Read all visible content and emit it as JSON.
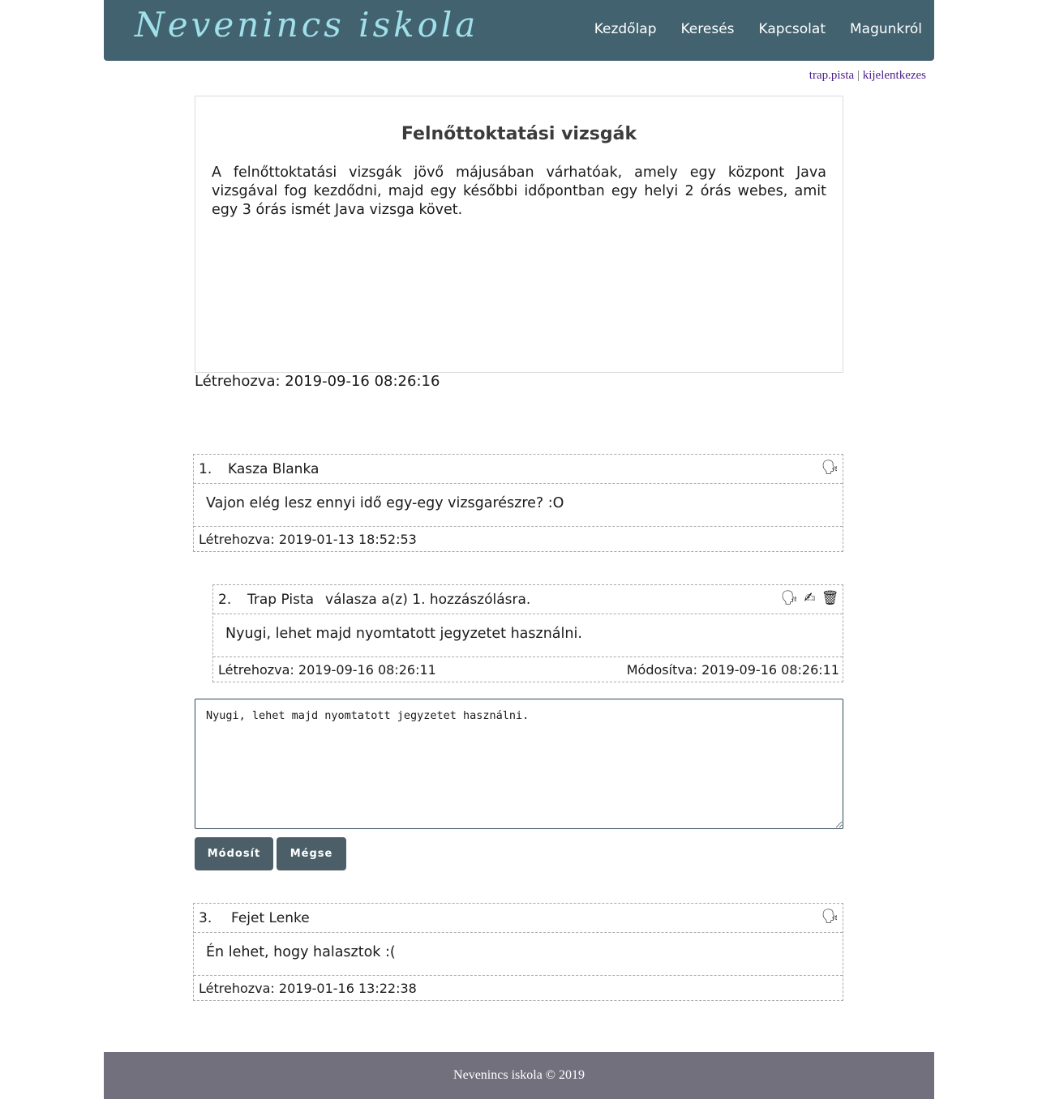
{
  "header": {
    "logo": "Nevenincs iskola",
    "nav": [
      "Kezdőlap",
      "Keresés",
      "Kapcsolat",
      "Magunkról"
    ]
  },
  "user": {
    "username": "trap.pista",
    "separator": "|",
    "logout": "kijelentkezes"
  },
  "article": {
    "title": "Felnőttoktatási vizsgák",
    "body": "A felnőttoktatási vizsgák jövő májusában várhatóak, amely egy központ Java vizsgával fog kezdődni, majd egy későbbi időpontban egy helyi 2 órás webes, amit egy 3 órás ismét Java vizsga követ.",
    "created": "Létrehozva: 2019-09-16 08:26:16"
  },
  "comments": [
    {
      "num": "1.",
      "author": "Kasza Blanka",
      "text": "Vajon elég lesz ennyi idő egy-egy vizsgarészre? :O",
      "created": "Létrehozva: 2019-01-13 18:52:53",
      "icons": [
        "speaking-head-icon"
      ]
    },
    {
      "num": "2.",
      "author": "Trap Pista",
      "reply_to": "válasza a(z) 1. hozzászólásra.",
      "text": "Nyugi, lehet majd nyomtatott jegyzetet használni.",
      "created": "Létrehozva: 2019-09-16 08:26:11",
      "modified": "Módosítva: 2019-09-16 08:26:11",
      "icons": [
        "speaking-head-icon",
        "writing-hand-icon",
        "wastebasket-icon"
      ]
    },
    {
      "num": "3.",
      "author": "Fejet Lenke",
      "text": "Én lehet, hogy halasztok :(",
      "created": "Létrehozva: 2019-01-16 13:22:38",
      "icons": [
        "speaking-head-icon"
      ]
    }
  ],
  "editor": {
    "value": "Nyugi, lehet majd nyomtatott jegyzetet használni.",
    "submit_label": "Módosít",
    "cancel_label": "Mégse"
  },
  "footer": {
    "text": "Nevenincs iskola © 2019"
  },
  "glyphs": {
    "speaking_head": "🗣",
    "writing_hand": "✍",
    "wastebasket": "🗑"
  }
}
